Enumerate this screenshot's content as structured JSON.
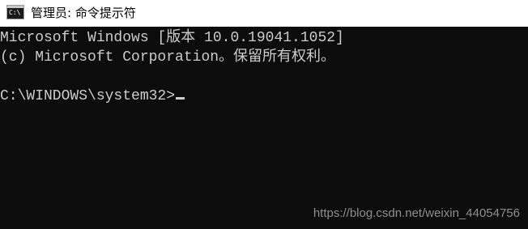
{
  "window": {
    "title": "管理员: 命令提示符",
    "icon": "cmd-icon",
    "icon_glyph": "C:\\"
  },
  "console": {
    "lines": [
      "Microsoft Windows [版本 10.0.19041.1052]",
      "(c) Microsoft Corporation。保留所有权利。",
      "",
      "C:\\WINDOWS\\system32>"
    ]
  },
  "watermark": "https://blog.csdn.net/weixin_44054756",
  "colors": {
    "console_background": "#0c0c0c",
    "console_text": "#cccccc",
    "titlebar_background": "#ffffff"
  }
}
